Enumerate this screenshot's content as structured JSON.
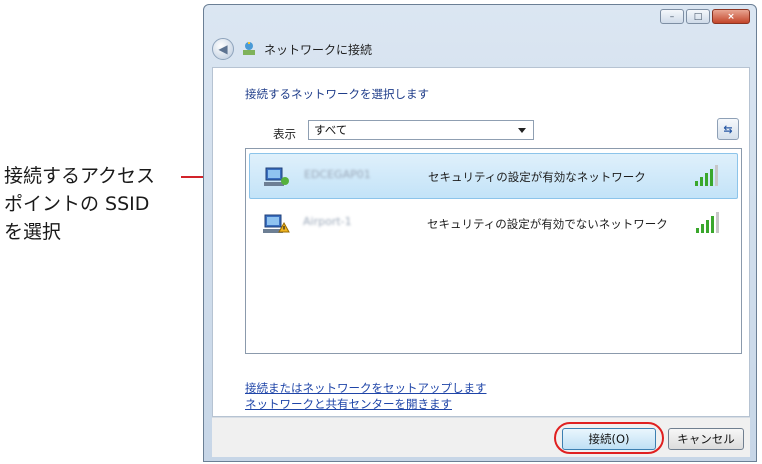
{
  "annotation": {
    "lines": [
      "接続するアクセス",
      "ポイントの SSID",
      "を選択"
    ]
  },
  "window": {
    "title": "ネットワークに接続",
    "caption_buttons": {
      "minimize": "–",
      "maximize": "□",
      "close": "×"
    }
  },
  "dialog": {
    "heading": "接続するネットワークを選択します",
    "show_label": "表示",
    "show_value": "すべて",
    "refresh_glyph": "⇆"
  },
  "networks": [
    {
      "ssid": "EDCEGAP01",
      "description": "セキュリティの設定が有効なネットワーク",
      "signal_bars": 4,
      "selected": true
    },
    {
      "ssid": "Airport-1",
      "description": "セキュリティの設定が有効でないネットワーク",
      "signal_bars": 4,
      "selected": false
    }
  ],
  "links": {
    "setup": "接続またはネットワークをセットアップします",
    "center": "ネットワークと共有センターを開きます"
  },
  "buttons": {
    "connect": "接続(O)",
    "cancel": "キャンセル"
  },
  "colors": {
    "accent": "#d2232a",
    "link": "#1f45a8",
    "signal": "#3aa72c"
  }
}
